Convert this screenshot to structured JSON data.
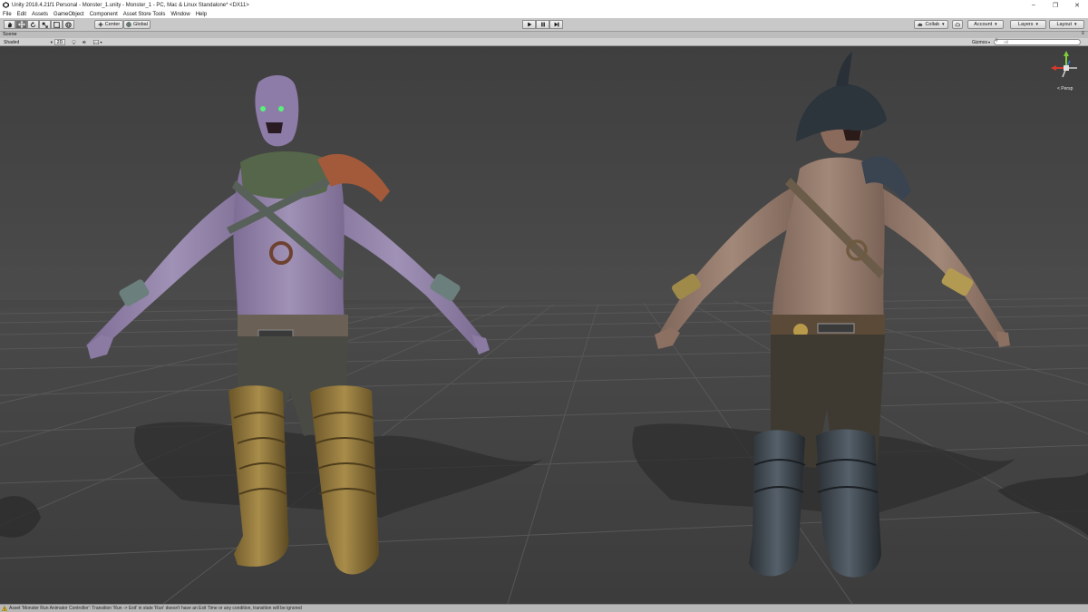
{
  "window": {
    "title": "Unity 2018.4.21f1 Personal - Monster_1.unity - Monster_1 - PC, Mac & Linux Standalone* <DX11>",
    "controls": [
      "minimize-icon",
      "maximize-icon",
      "close-icon"
    ]
  },
  "menu": [
    "File",
    "Edit",
    "Assets",
    "GameObject",
    "Component",
    "Asset Store Tools",
    "Window",
    "Help"
  ],
  "toolbar": {
    "tools": [
      "hand-icon",
      "move-icon",
      "rotate-icon",
      "scale-icon",
      "rect-icon",
      "transform-icon"
    ],
    "pivot_label": "Center",
    "space_label": "Global",
    "play_controls": [
      "play-icon",
      "pause-icon",
      "step-icon"
    ],
    "collab_label": "Collab",
    "account_label": "Account",
    "layers_label": "Layers",
    "layout_label": "Layout"
  },
  "scene": {
    "tab_label": "Scene",
    "shading_label": "Shaded",
    "mode_2d_label": "2D",
    "gizmos_label": "Gizmos",
    "search_placeholder": "All",
    "persp_label": "< Persp"
  },
  "colors": {
    "grid_ground": "#454545",
    "sky": "#474747",
    "gizmo_x": "#d23a2c",
    "gizmo_y": "#7ed03a",
    "gizmo_z": "#3a72d2"
  },
  "status": {
    "message": "Asset 'Monster Run Animator Controller': Transition 'Run -> Exit' in state 'Run' doesn't have an Exit Time or any condition, transition will be ignored"
  }
}
